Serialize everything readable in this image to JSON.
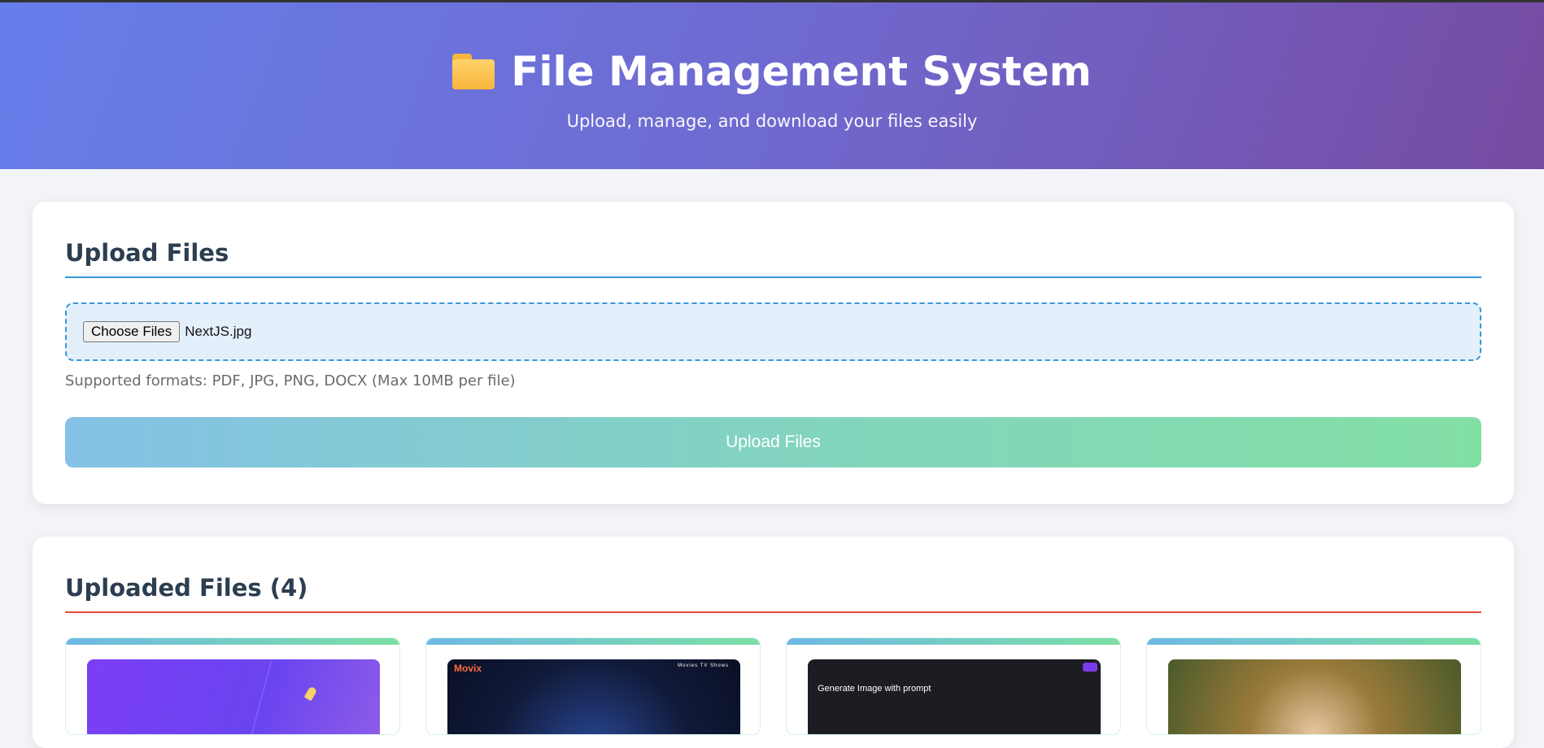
{
  "header": {
    "icon": "folder-icon",
    "title": "File Management System",
    "subtitle": "Upload, manage, and download your files easily"
  },
  "upload": {
    "title": "Upload Files",
    "choose_label": "Choose Files",
    "selected_file": "NextJS.jpg",
    "hint": "Supported formats: PDF, JPG, PNG, DOCX (Max 10MB per file)",
    "button_label": "Upload Files"
  },
  "files": {
    "title": "Uploaded Files (4)",
    "thumbs": {
      "movix_logo": "Movix",
      "movix_nav": "Movies   TV Shows",
      "prompt_title": "Generate Image with prompt"
    }
  },
  "colors": {
    "accent_blue": "#3498db",
    "accent_red": "#e74c3c",
    "header_start": "#667eea",
    "header_end": "#764ba2"
  }
}
